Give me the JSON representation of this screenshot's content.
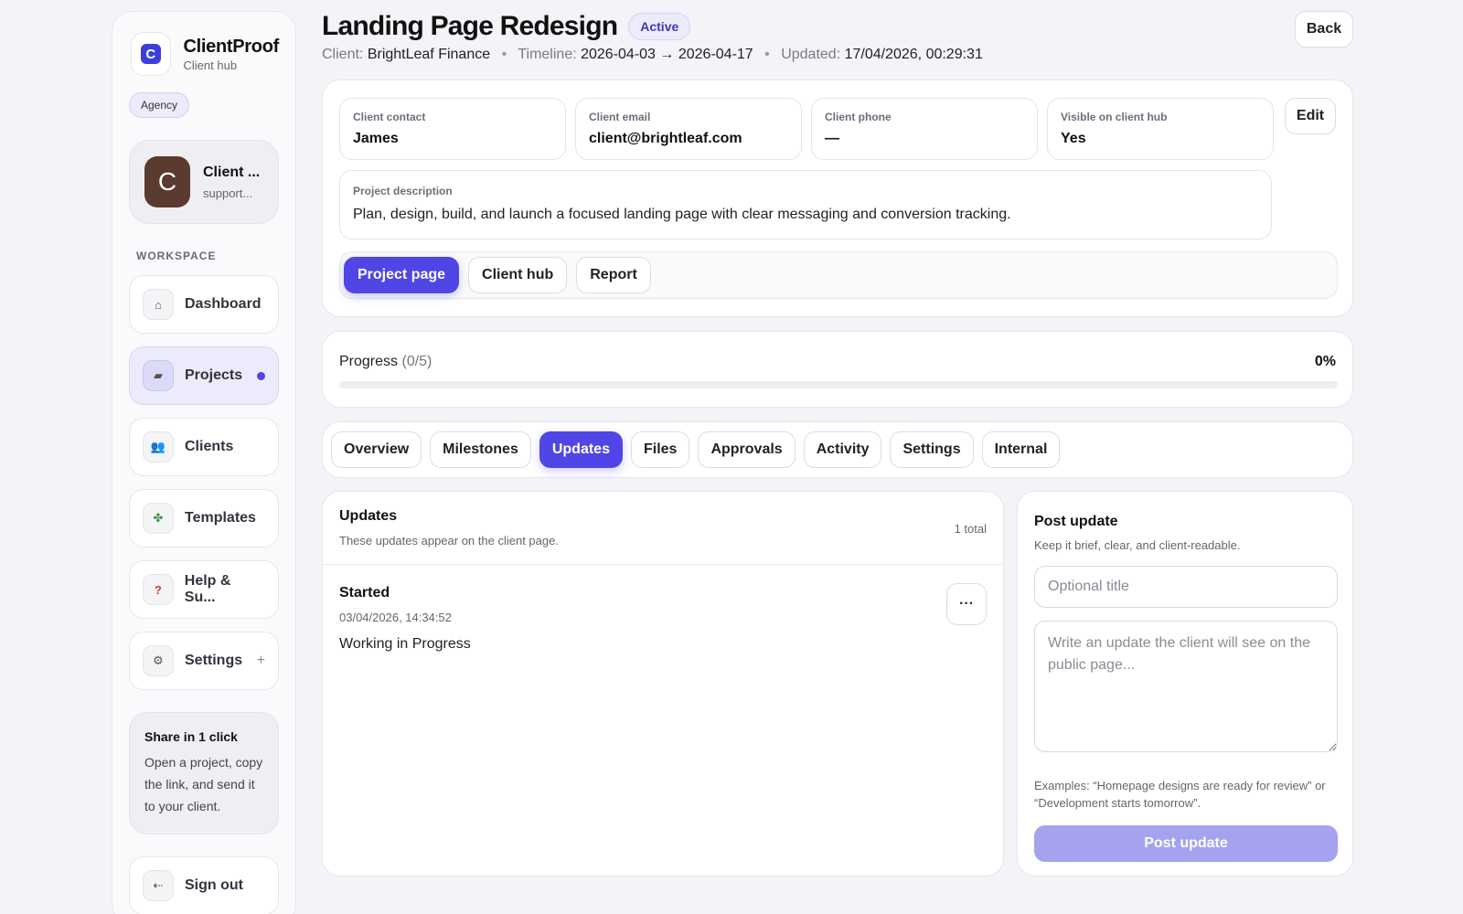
{
  "brand": {
    "logo_letter": "C",
    "name": "ClientProof",
    "sub": "Client hub",
    "badge": "Agency"
  },
  "account": {
    "avatar_letter": "C",
    "name": "Client ...",
    "email": "support..."
  },
  "sidebar": {
    "section_label": "WORKSPACE",
    "items": [
      {
        "label": "Dashboard",
        "icon": "home-icon",
        "glyph": "⌂"
      },
      {
        "label": "Projects",
        "icon": "folder-icon",
        "glyph": "▰",
        "active": true
      },
      {
        "label": "Clients",
        "icon": "users-icon",
        "glyph": "👥"
      },
      {
        "label": "Templates",
        "icon": "puzzle-icon",
        "glyph": "✤"
      },
      {
        "label": "Help & Su...",
        "icon": "help-icon",
        "glyph": "?"
      },
      {
        "label": "Settings",
        "icon": "gear-icon",
        "glyph": "⚙",
        "trailing": "+"
      }
    ],
    "share": {
      "title": "Share in 1 click",
      "text": "Open a project, copy the link, and send it to your client."
    },
    "signout": {
      "label": "Sign out",
      "icon": "sign-out-icon",
      "glyph": "⇠"
    }
  },
  "header": {
    "title": "Landing Page Redesign",
    "status": "Active",
    "client_label": "Client:",
    "client_value": "BrightLeaf Finance",
    "timeline_label": "Timeline:",
    "timeline_value": "2026-04-03 → 2026-04-17",
    "updated_label": "Updated:",
    "updated_value": "17/04/2026, 00:29:31",
    "separator": "•",
    "back_label": "Back"
  },
  "info": {
    "fields": [
      {
        "label": "Client contact",
        "value": "James"
      },
      {
        "label": "Client email",
        "value": "client@brightleaf.com"
      },
      {
        "label": "Client phone",
        "value": "—"
      },
      {
        "label": "Visible on client hub",
        "value": "Yes"
      }
    ],
    "edit_label": "Edit",
    "description_label": "Project description",
    "description": "Plan, design, build, and launch a focused landing page with clear messaging and conversion tracking.",
    "links": [
      "Project page",
      "Client hub",
      "Report"
    ]
  },
  "progress": {
    "label": "Progress",
    "fraction": "(0/5)",
    "percent": "0%",
    "value": 0
  },
  "tabs": [
    "Overview",
    "Milestones",
    "Updates",
    "Files",
    "Approvals",
    "Activity",
    "Settings",
    "Internal"
  ],
  "active_tab": "Updates",
  "updates": {
    "title": "Updates",
    "subtitle": "These updates appear on the client page.",
    "count": "1 total",
    "items": [
      {
        "title": "Started",
        "date": "03/04/2026, 14:34:52",
        "body": "Working in Progress",
        "menu": "···"
      }
    ]
  },
  "post": {
    "title": "Post update",
    "subtitle": "Keep it brief, clear, and client-readable.",
    "title_placeholder": "Optional title",
    "body_placeholder": "Write an update the client will see on the public page...",
    "hint": "Examples: “Homepage designs are ready for review” or “Development starts tomorrow”.",
    "button": "Post update"
  },
  "colors": {
    "accent": "#4f46e5",
    "accent_disabled": "#a5a2f0",
    "avatar": "#5b3a30"
  }
}
